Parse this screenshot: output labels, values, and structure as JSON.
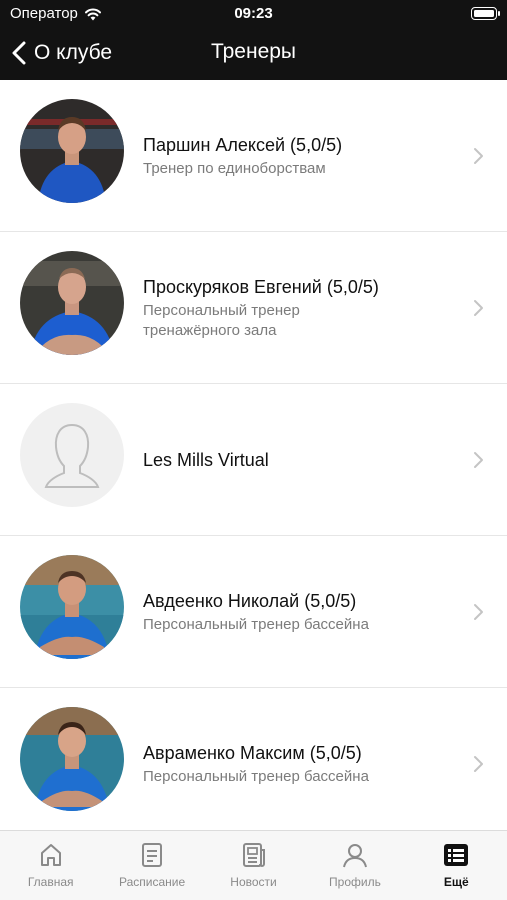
{
  "status": {
    "carrier": "Оператор",
    "time": "09:23"
  },
  "nav": {
    "back_label": "О клубе",
    "title": "Тренеры"
  },
  "trainers": [
    {
      "name": " Паршин Алексей (5,0/5)",
      "subtitle": "Тренер по единоборствам",
      "photo": "trainer-photo"
    },
    {
      "name": " Проскуряков Евгений (5,0/5)",
      "subtitle": "Персональный тренер тренажёрного зала",
      "photo": "trainer-photo"
    },
    {
      "name": "Les Mills Virtual",
      "subtitle": "",
      "photo": "placeholder-person-icon"
    },
    {
      "name": "Авдеенко Николай (5,0/5)",
      "subtitle": "Персональный тренер бассейна",
      "photo": "trainer-photo"
    },
    {
      "name": "Авраменко Максим (5,0/5)",
      "subtitle": "Персональный тренер бассейна",
      "photo": "trainer-photo"
    }
  ],
  "tabs": [
    {
      "label": "Главная",
      "icon": "home-icon",
      "active": false
    },
    {
      "label": "Расписание",
      "icon": "schedule-icon",
      "active": false
    },
    {
      "label": "Новости",
      "icon": "news-icon",
      "active": false
    },
    {
      "label": "Профиль",
      "icon": "profile-icon",
      "active": false
    },
    {
      "label": "Ещё",
      "icon": "more-list-icon",
      "active": true
    }
  ],
  "colors": {
    "topbar": "#121212",
    "secondary_text": "#7b7b7b",
    "tab_inactive": "#8a8a8a",
    "tab_active": "#111111"
  }
}
